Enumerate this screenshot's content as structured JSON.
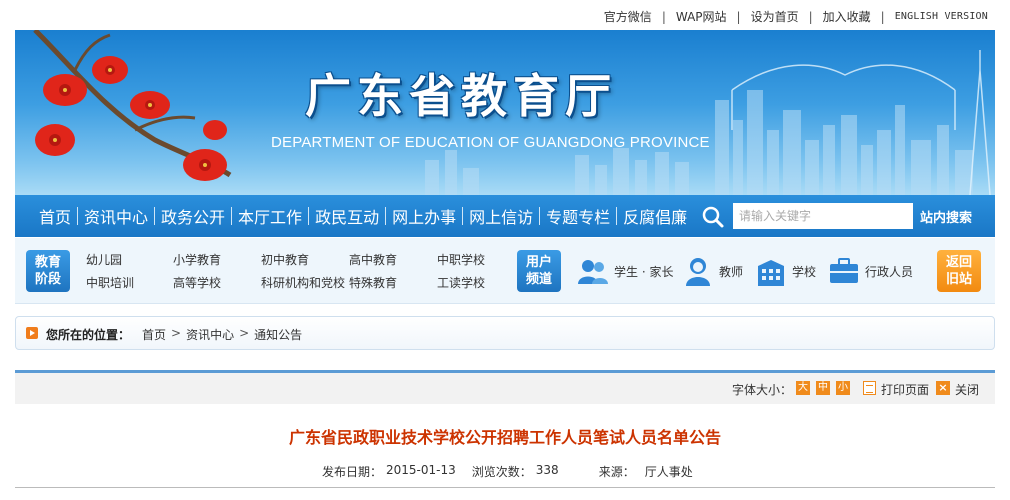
{
  "top_links": {
    "wechat": "官方微信",
    "wap": "WAP网站",
    "homepage": "设为首页",
    "favorite": "加入收藏",
    "english": "ENGLISH VERSION"
  },
  "banner": {
    "title_cn": "广东省教育厅",
    "title_en": "DEPARTMENT OF EDUCATION OF GUANGDONG PROVINCE"
  },
  "nav": {
    "items": [
      "首页",
      "资讯中心",
      "政务公开",
      "本厅工作",
      "政民互动",
      "网上办事",
      "网上信访",
      "专题专栏",
      "反腐倡廉"
    ],
    "search_placeholder": "请输入关键字",
    "search_button": "站内搜索"
  },
  "channels": {
    "stage_tag": [
      "教育",
      "阶段"
    ],
    "stages_row1": [
      "幼儿园",
      "小学教育",
      "初中教育",
      "高中教育",
      "中职学校"
    ],
    "stages_row2": [
      "中职培训",
      "高等学校",
      "科研机构和党校",
      "特殊教育",
      "工读学校"
    ],
    "user_tag": [
      "用户",
      "频道"
    ],
    "users": [
      "学生 · 家长",
      "教师",
      "学校",
      "行政人员"
    ],
    "back_tag": [
      "返回",
      "旧站"
    ]
  },
  "breadcrumb": {
    "label": "您所在的位置：",
    "items": [
      "首页",
      "资讯中心",
      "通知公告"
    ]
  },
  "toolbar": {
    "font_size_label": "字体大小：",
    "sizes": [
      "大",
      "中",
      "小"
    ],
    "print": "打印页面",
    "close": "关闭"
  },
  "article": {
    "title": "广东省民政职业技术学校公开招聘工作人员笔试人员名单公告",
    "publish_label": "发布日期：",
    "publish_date": "2015-01-13",
    "views_label": "浏览次数：",
    "views": "338",
    "source_label": "来源：",
    "source": "厅人事处"
  },
  "colors": {
    "nav_blue": "#1a77c6",
    "accent_orange": "#f08b1c",
    "title_red": "#cc3300"
  }
}
